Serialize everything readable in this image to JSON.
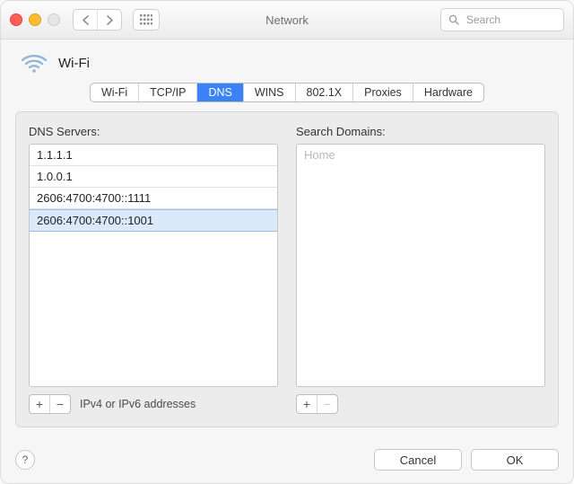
{
  "window": {
    "title": "Network"
  },
  "search": {
    "placeholder": "Search"
  },
  "header": {
    "connection_name": "Wi-Fi"
  },
  "tabs": {
    "items": [
      {
        "label": "Wi-Fi"
      },
      {
        "label": "TCP/IP"
      },
      {
        "label": "DNS"
      },
      {
        "label": "WINS"
      },
      {
        "label": "802.1X"
      },
      {
        "label": "Proxies"
      },
      {
        "label": "Hardware"
      }
    ],
    "active_index": 2
  },
  "dns": {
    "label": "DNS Servers:",
    "servers": [
      "1.1.1.1",
      "1.0.0.1",
      "2606:4700:4700::1111",
      "2606:4700:4700::1001"
    ],
    "selected_index": 3,
    "hint": "IPv4 or IPv6 addresses"
  },
  "search_domains": {
    "label": "Search Domains:",
    "placeholder": "Home",
    "items": []
  },
  "buttons": {
    "help": "?",
    "cancel": "Cancel",
    "ok": "OK",
    "plus": "+",
    "minus": "−"
  }
}
